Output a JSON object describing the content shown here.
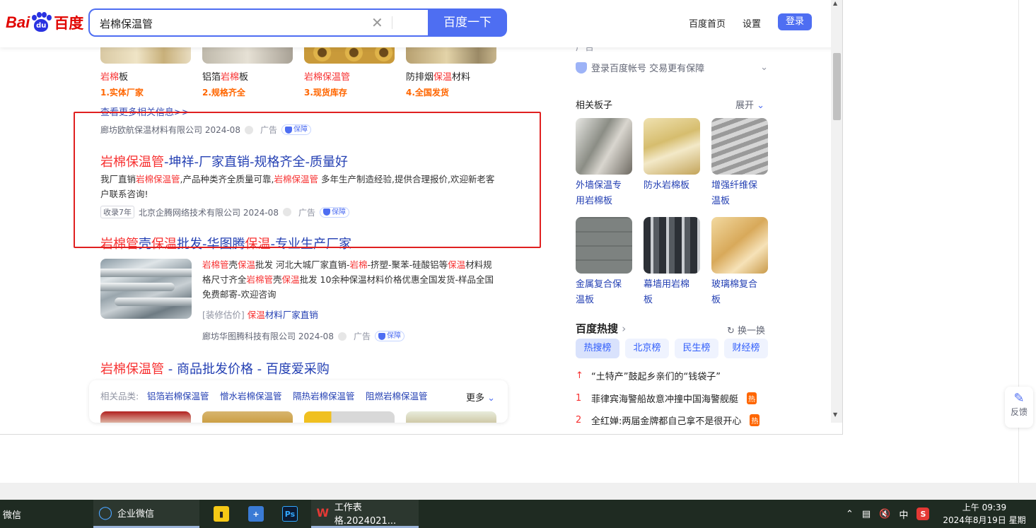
{
  "header": {
    "logo_bai": "Bai",
    "logo_du": "du",
    "logo_cn": "百度",
    "query": "岩棉保温管",
    "search_button": "百度一下",
    "home_link": "百度首页",
    "settings_link": "设置",
    "login_button": "登录"
  },
  "products": [
    {
      "pre": "",
      "hl": "岩棉",
      "post": "板",
      "tag": "1.实体厂家"
    },
    {
      "pre": "铝箔",
      "hl": "岩棉",
      "post": "板",
      "tag": "2.规格齐全"
    },
    {
      "pre": "",
      "hl": "岩棉保温管",
      "post": "",
      "tag": "3.现货库存"
    },
    {
      "pre": "防排烟",
      "hl": "保温",
      "post": "材料",
      "tag": "4.全国发货"
    }
  ],
  "more_info": "查看更多相关信息>>",
  "ad1": {
    "company": "廊坊欧航保温材料有限公司 2024-08",
    "ad_label": "广告",
    "guarantee": "保障"
  },
  "result1": {
    "title_hl": "岩棉保温管",
    "title_rest": "-坤祥-厂家直销-规格齐全-质量好",
    "desc_a": "我厂直销",
    "desc_hl1": "岩棉保温管",
    "desc_b": ",产品种类齐全质量可靠,",
    "desc_hl2": "岩棉保温管",
    "desc_c": " 多年生产制造经验,提供合理报价,欢迎新老客户联系咨询!",
    "tag": "收录7年",
    "company": "北京企腾网络技术有限公司 2024-08",
    "ad_label": "广告",
    "guarantee": "保障"
  },
  "result2": {
    "t1": "岩棉管",
    "t2": "壳",
    "t3": "保温",
    "t4": "批发-华图腾",
    "t5": "保温",
    "t6": "-专业生产厂家",
    "d1": "岩棉管",
    "d2": "壳",
    "d3": "保温",
    "d4": "批发 河北大城厂家直销-",
    "d5": "岩棉",
    "d6": "-挤塑-聚苯-硅酸铝等",
    "d7": "保温",
    "d8": "材料规格尺寸齐全",
    "d9": "岩棉管",
    "d10": "壳",
    "d11": "保温",
    "d12": "批发 10余种保温材料价格优惠全国发货-样品全国免费邮寄-欢迎咨询",
    "sub_gray": "[装修估价]",
    "sub_hl": "保温",
    "sub_rest": "材料厂家直销",
    "company": "廊坊华图腾科技有限公司 2024-08",
    "ad_label": "广告",
    "guarantee": "保障"
  },
  "result3": {
    "title_hl": "岩棉保温管",
    "title_rest": " - 商品批发价格 - 百度爱采购"
  },
  "related": {
    "label": "相关品类:",
    "links": [
      "铝箔岩棉保温管",
      "憎水岩棉保温管",
      "隔热岩棉保温管",
      "阻燃岩棉保温管"
    ],
    "more": "更多"
  },
  "sidebar": {
    "ad_small": "广告",
    "account_link": "登录百度帐号 交易更有保障",
    "boards_title": "相关板子",
    "expand": "展开",
    "boards": [
      {
        "l1": "外墙保温专",
        "l2": "用岩棉板"
      },
      {
        "l1": "防水岩棉板",
        "l2": ""
      },
      {
        "l1": "增强纤维保",
        "l2": "温板"
      },
      {
        "l1": "金属复合保",
        "l2": "温板"
      },
      {
        "l1": "幕墙用岩棉",
        "l2": "板"
      },
      {
        "l1": "玻璃棉复合",
        "l2": "板"
      }
    ],
    "hot_title": "百度热搜",
    "refresh": "换一换",
    "hot_tabs": [
      "热搜榜",
      "北京榜",
      "民生榜",
      "财经榜"
    ],
    "hot_items": [
      {
        "rank": "↑",
        "text": "“土特产”鼓起乡亲们的“钱袋子”",
        "badge": ""
      },
      {
        "rank": "1",
        "text": "菲律宾海警船故意冲撞中国海警舰艇",
        "badge": "热"
      },
      {
        "rank": "2",
        "text": "全红婵:两届金牌都自己拿不是很开心",
        "badge": "热"
      }
    ]
  },
  "feedback": "反馈",
  "taskbar": {
    "wechat": "微信",
    "wework": "企业微信",
    "wps": "工作表格.2024021...",
    "ime": "中",
    "time": "上午 09:39",
    "date": "2024年8月19日 星期一"
  },
  "colors": {
    "accent": "#4e6ef2",
    "highlight": "#f73131",
    "link": "#2440b3",
    "annotation": "#e02020"
  }
}
